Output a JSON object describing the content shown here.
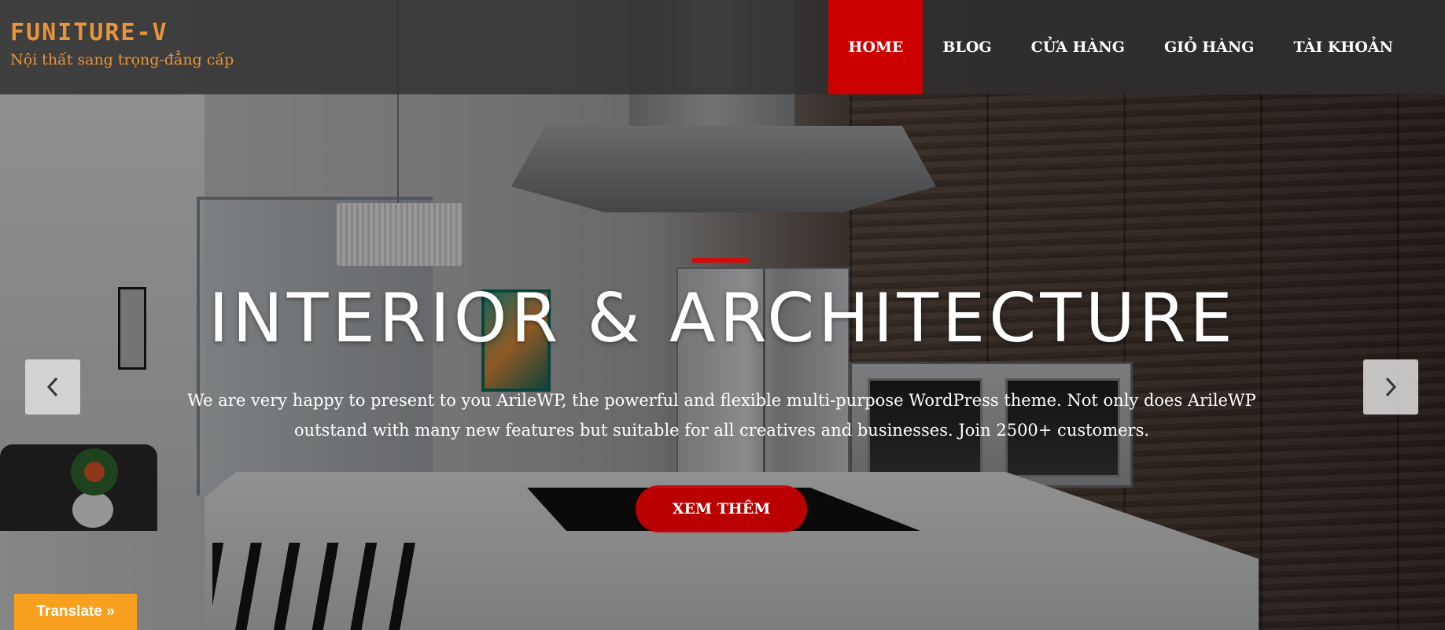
{
  "header": {
    "site_title": "FUNITURE-V",
    "tagline": "Nội thất sang trọng-đẳng cấp",
    "nav": [
      {
        "label": "HOME",
        "active": true
      },
      {
        "label": "BLOG",
        "active": false
      },
      {
        "label": "CỬA HÀNG",
        "active": false
      },
      {
        "label": "GIỎ HÀNG",
        "active": false
      },
      {
        "label": "TÀI KHOẢN",
        "active": false
      }
    ]
  },
  "slide": {
    "title": "INTERIOR & ARCHITECTURE",
    "description": "We are very happy to present to you ArileWP, the powerful and flexible multi-purpose WordPress theme. Not only does ArileWP outstand with many new features but suitable for all creatives and businesses. Join 2500+ customers.",
    "cta_label": "XEM THÊM"
  },
  "slider": {
    "prev_icon": "chevron-left-icon",
    "next_icon": "chevron-right-icon"
  },
  "translate_widget": {
    "label": "Translate »"
  },
  "colors": {
    "brand": "#e8943a",
    "accent": "#cc0000",
    "translate": "#f79f1e"
  }
}
